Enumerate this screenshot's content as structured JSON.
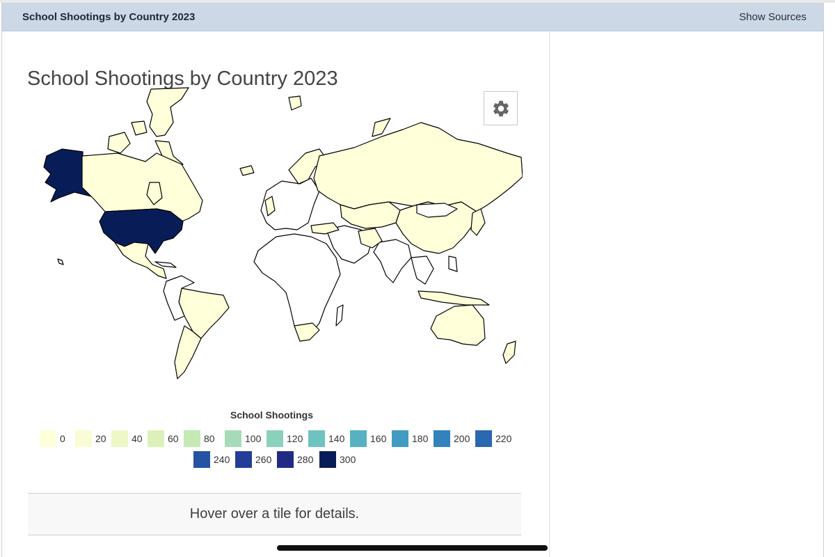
{
  "window": {
    "title": "School Shootings by Country 2023",
    "show_sources_label": "Show Sources"
  },
  "page": {
    "title": "School Shootings by Country 2023",
    "details_text": "Hover over a tile for details."
  },
  "map": {
    "settings_icon": "gear-icon",
    "no_data_color": "#ffffff",
    "border_color": "#000000",
    "regions": [
      {
        "name": "Alaska",
        "value": 300
      },
      {
        "name": "United States",
        "value": 300
      },
      {
        "name": "Canada",
        "value": 0
      },
      {
        "name": "Greenland",
        "value": 0
      },
      {
        "name": "Mexico",
        "value": 0
      },
      {
        "name": "Brazil",
        "value": 0
      },
      {
        "name": "Argentina",
        "value": 0
      },
      {
        "name": "Russia",
        "value": 0
      },
      {
        "name": "China",
        "value": 0
      },
      {
        "name": "Australia",
        "value": 0
      },
      {
        "name": "South Africa",
        "value": 0
      },
      {
        "name": "Iran",
        "value": 0
      },
      {
        "name": "Turkey",
        "value": 0
      },
      {
        "name": "Japan",
        "value": 0
      }
    ]
  },
  "legend": {
    "title": "School Shootings",
    "items": [
      {
        "label": "0",
        "color": "#ffffd9"
      },
      {
        "label": "20",
        "color": "#fafdd3"
      },
      {
        "label": "40",
        "color": "#eef8c7"
      },
      {
        "label": "60",
        "color": "#dbf1b9"
      },
      {
        "label": "80",
        "color": "#c4e9b4"
      },
      {
        "label": "100",
        "color": "#a5dcb7"
      },
      {
        "label": "120",
        "color": "#89d1bb"
      },
      {
        "label": "140",
        "color": "#6ec3c1"
      },
      {
        "label": "160",
        "color": "#56b1c1"
      },
      {
        "label": "180",
        "color": "#409cc0"
      },
      {
        "label": "200",
        "color": "#3282bb"
      },
      {
        "label": "220",
        "color": "#2a68b0"
      },
      {
        "label": "240",
        "color": "#2553a4"
      },
      {
        "label": "260",
        "color": "#233e98"
      },
      {
        "label": "280",
        "color": "#202c84"
      },
      {
        "label": "300",
        "color": "#081d58"
      }
    ]
  }
}
